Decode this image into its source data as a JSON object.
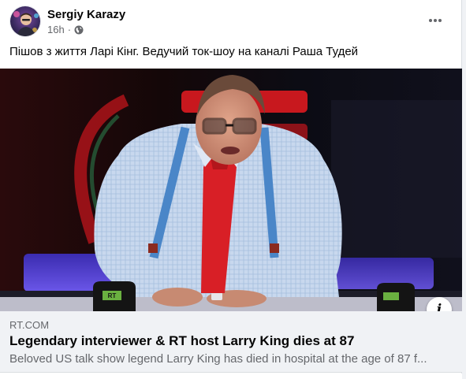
{
  "post": {
    "author": "Sergiy Karazy",
    "time": "16h",
    "separator": "·",
    "privacy_icon": "globe-icon",
    "more_icon": "more-horizontal-icon",
    "caption": "Пішов з життя Ларі Кінг. Ведучий ток-шоу на каналі Раша Тудей"
  },
  "link_preview": {
    "domain": "RT.COM",
    "title": "Legendary interviewer & RT host Larry King dies at 87",
    "description": "Beloved US talk show legend Larry King has died in hospital at the age of 87 f...",
    "info_icon": "info-icon",
    "info_glyph": "i",
    "mug_text": "RT"
  },
  "colors": {
    "text_primary": "#050505",
    "text_secondary": "#65676b",
    "preview_bg": "#f0f2f5",
    "tie_red": "#d81f26",
    "suspender_blue": "#4a86c8"
  }
}
